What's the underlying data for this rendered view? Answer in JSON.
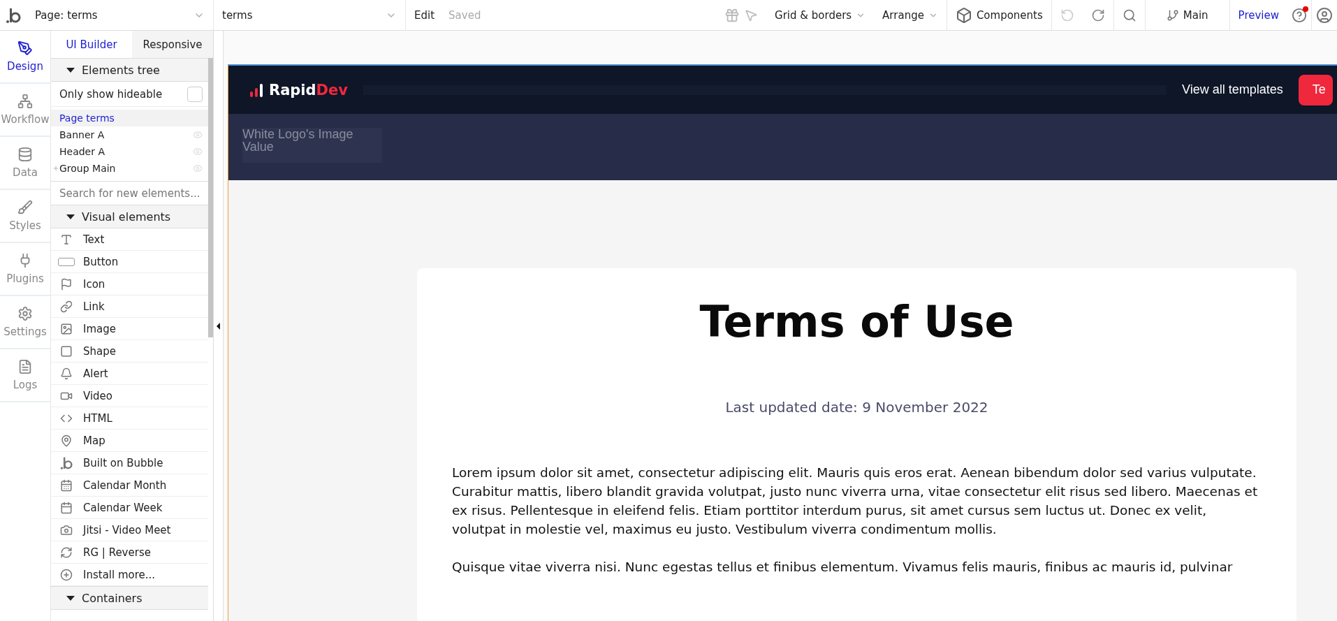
{
  "topbar": {
    "page_select": "Page: terms",
    "element_select": "terms",
    "edit": "Edit",
    "saved": "Saved",
    "grid": "Grid & borders",
    "arrange": "Arrange",
    "components": "Components",
    "branch": "Main",
    "preview": "Preview",
    "help_notification": true
  },
  "rail": [
    {
      "label": "Design",
      "selected": true
    },
    {
      "label": "Workflow",
      "selected": false
    },
    {
      "label": "Data",
      "selected": false
    },
    {
      "label": "Styles",
      "selected": false
    },
    {
      "label": "Plugins",
      "selected": false
    },
    {
      "label": "Settings",
      "selected": false
    },
    {
      "label": "Logs",
      "selected": false
    }
  ],
  "panel": {
    "tabs": [
      {
        "label": "UI Builder",
        "selected": true
      },
      {
        "label": "Responsive",
        "selected": false
      }
    ],
    "tree_header": {
      "label": "Elements tree",
      "expanded": true
    },
    "hideable": {
      "label": "Only show hideable",
      "checked": false
    },
    "tree": [
      {
        "label": "Page terms",
        "selected": true,
        "eye": false,
        "collapsed": false
      },
      {
        "label": "Banner A",
        "selected": false,
        "eye": true,
        "collapsed": false
      },
      {
        "label": "Header A",
        "selected": false,
        "eye": true,
        "collapsed": false
      },
      {
        "label": "Group Main",
        "selected": false,
        "eye": true,
        "collapsed": true
      }
    ],
    "search": {
      "placeholder": "Search for new elements..."
    },
    "visual_header": {
      "label": "Visual elements",
      "expanded": true
    },
    "elements": [
      "Text",
      "Button",
      "Icon",
      "Link",
      "Image",
      "Shape",
      "Alert",
      "Video",
      "HTML",
      "Map",
      "Built on Bubble",
      "Calendar Month",
      "Calendar Week",
      "Jitsi - Video Meet",
      "RG | Reverse",
      "Install more..."
    ],
    "containers_header": {
      "label": "Containers",
      "expanded": true
    }
  },
  "page": {
    "logo_left": "Rapid",
    "logo_right": "Dev",
    "nav_link": "View all templates",
    "cta": "Te",
    "image_placeholder": "White Logo's Image Value",
    "title": "Terms of Use",
    "updated": "Last updated date: 9 November 2022",
    "paragraphs": [
      "Lorem ipsum dolor sit amet, consectetur adipiscing elit. Mauris quis eros erat. Aenean bibendum dolor sed varius vulputate. Curabitur mattis, libero blandit gravida volutpat, justo nunc viverra urna, vitae consectetur elit risus sed libero. Maecenas et ex risus. Pellentesque in eleifend felis. Etiam porttitor interdum purus, sit amet cursus sem luctus ut. Donec ex velit, volutpat in molestie vel, maximus eu justo. Vestibulum viverra condimentum mollis.",
      "Quisque vitae viverra nisi. Nunc egestas tellus et finibus elementum. Vivamus felis mauris, finibus ac mauris id, pulvinar"
    ]
  }
}
